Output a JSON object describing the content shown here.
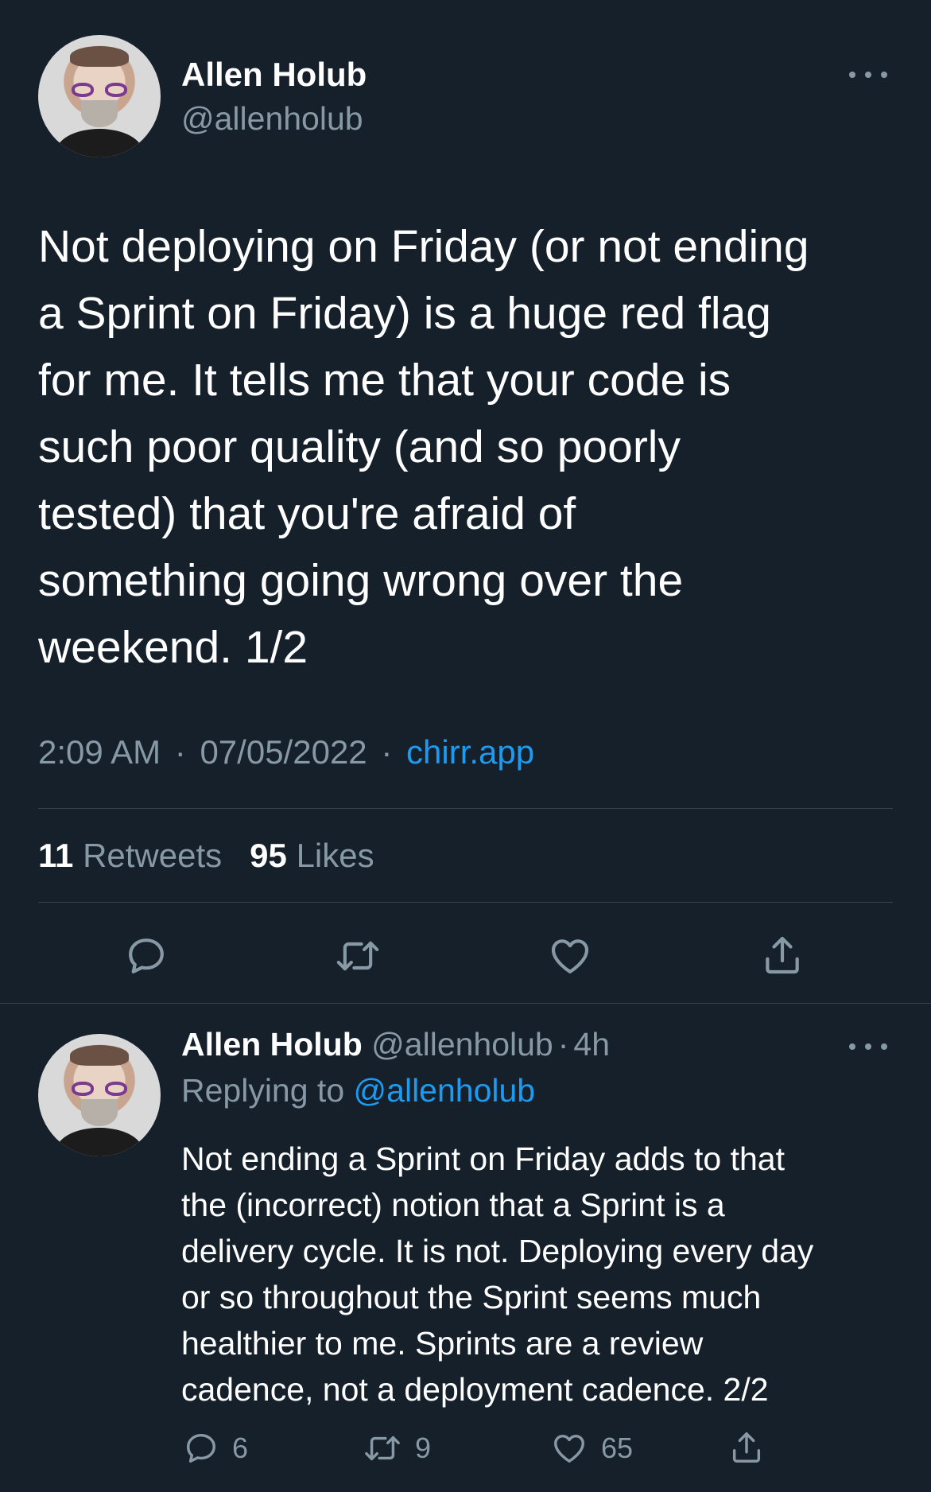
{
  "main_tweet": {
    "author": {
      "name": "Allen Holub",
      "handle": "@allenholub"
    },
    "text": "Not deploying on Friday (or not ending\na Sprint on Friday) is a huge red flag\nfor me. It tells me that your code is\nsuch poor quality (and so poorly\ntested) that you're afraid of\nsomething going wrong over the\nweekend. 1/2",
    "time": "2:09 AM",
    "separator": "·",
    "date": "07/05/2022",
    "source": "chirr.app",
    "retweets_count": "11",
    "retweets_label": "Retweets",
    "likes_count": "95",
    "likes_label": "Likes",
    "actions": [
      "reply-icon",
      "retweet-icon",
      "like-icon",
      "share-icon"
    ]
  },
  "reply_tweet": {
    "author": {
      "name": "Allen Holub",
      "handle": "@allenholub"
    },
    "separator": "·",
    "age": "4h",
    "replying_label": "Replying to",
    "replying_to": "@allenholub",
    "text": "Not ending a Sprint on Friday adds to that\nthe (incorrect) notion that a Sprint is a\ndelivery cycle. It is not. Deploying every day\nor so throughout the Sprint seems much\nhealthier to me. Sprints are a review\ncadence, not a deployment cadence. 2/2",
    "reply_count": "6",
    "retweet_count": "9",
    "like_count": "65"
  },
  "colors": {
    "background": "#15202b",
    "text": "#ffffff",
    "secondary": "#8899a6",
    "accent": "#1d9bf0",
    "divider": "#38444d"
  }
}
